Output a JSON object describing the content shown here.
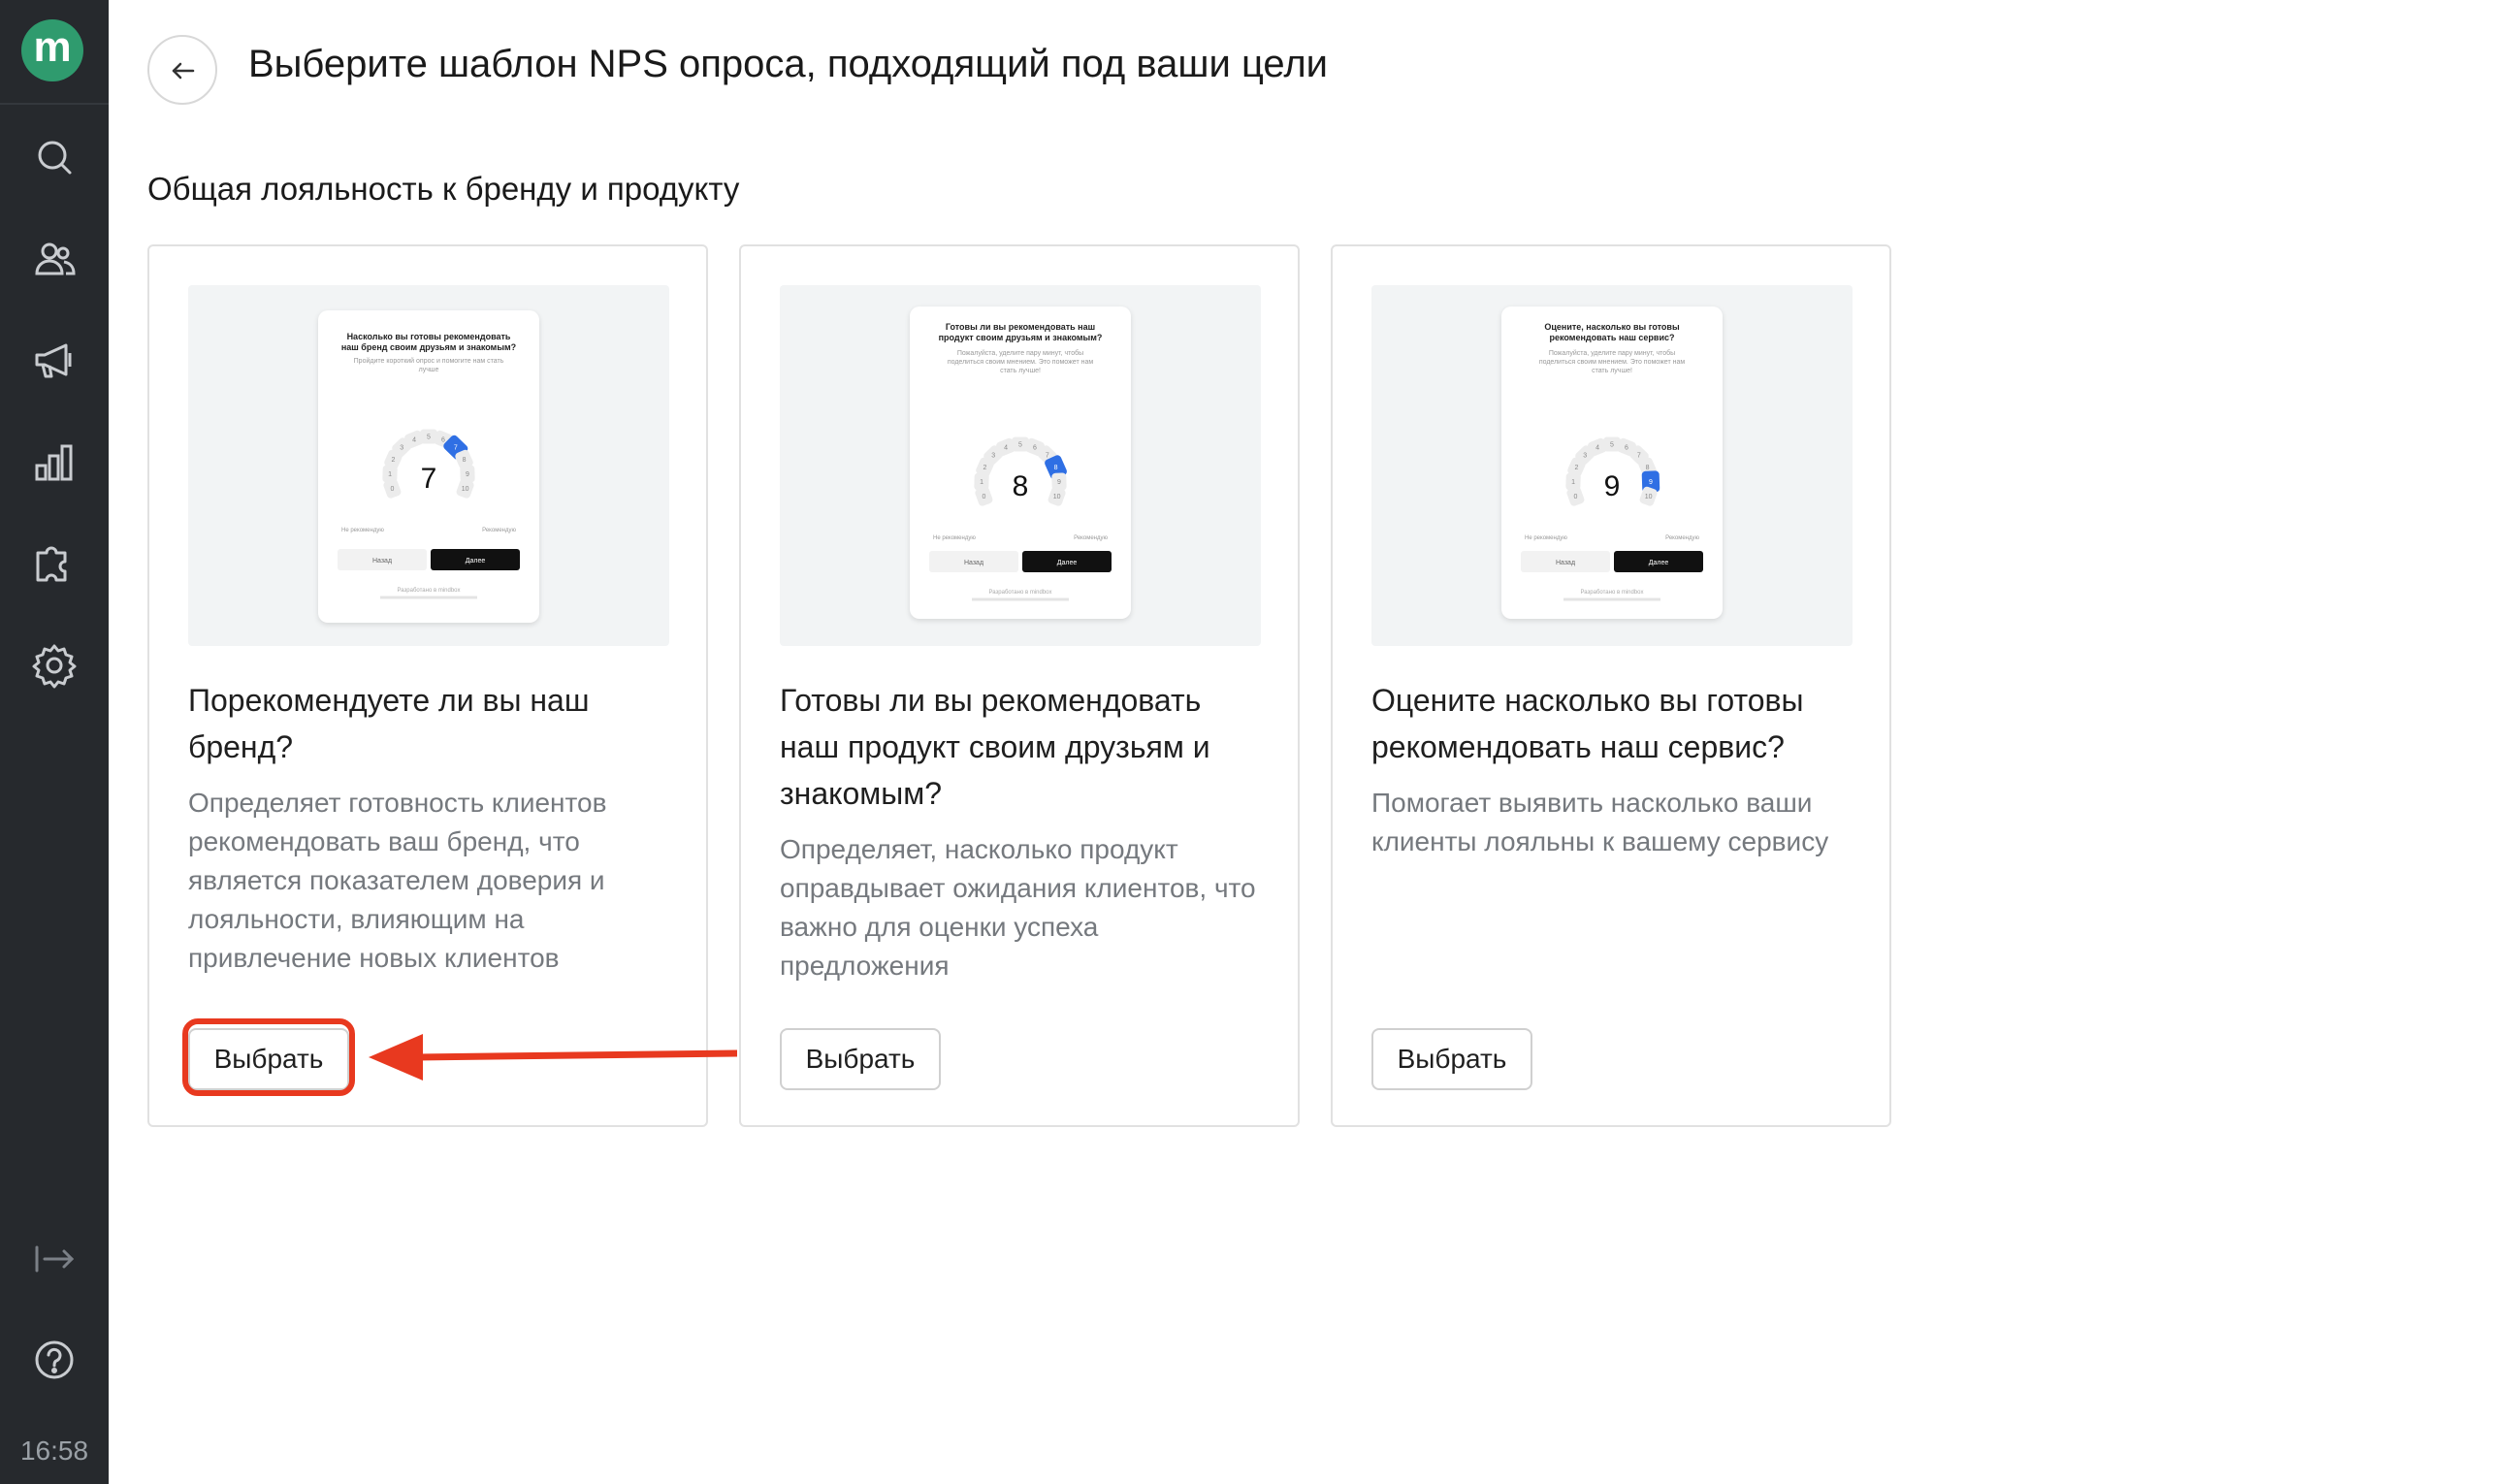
{
  "sidebar": {
    "logo_letter": "m",
    "icons": [
      "search-icon",
      "users-icon",
      "megaphone-icon",
      "chart-icon",
      "puzzle-icon",
      "gear-icon",
      "logout-icon",
      "help-icon"
    ],
    "clock": "16:58"
  },
  "header": {
    "title": "Выберите шаблон NPS опроса, подходящий под ваши цели"
  },
  "section": {
    "title": "Общая лояльность к бренду и продукту"
  },
  "cards": [
    {
      "title": "Порекомендуете ли вы наш бренд?",
      "description": "Определяет готовность клиентов рекомендовать ваш бренд, что является показателем доверия и лояльности, влияющим на привлечение новых клиентов",
      "button": "Выбрать",
      "preview": {
        "question": "Насколько вы готовы рекомендовать наш бренд своим друзьям и знакомым?",
        "hint": "Пройдите короткий опрос и помогите нам стать лучше",
        "score": "7",
        "low_label": "Не рекомендую",
        "high_label": "Рекомендую",
        "back": "Назад",
        "next": "Далее",
        "footer": "Разработано в mindbox"
      }
    },
    {
      "title": "Готовы ли вы рекомендовать наш продукт своим друзьям и знакомым?",
      "description": "Определяет, насколько продукт оправдывает ожидания клиентов, что важно для оценки успеха предложения",
      "button": "Выбрать",
      "preview": {
        "question": "Готовы ли вы рекомендовать наш продукт своим друзьям и знакомым?",
        "hint": "Пожалуйста, уделите пару минут, чтобы поделиться своим мнением. Это поможет нам стать лучше!",
        "score": "8",
        "low_label": "Не рекомендую",
        "high_label": "Рекомендую",
        "back": "Назад",
        "next": "Далее",
        "footer": "Разработано в mindbox"
      }
    },
    {
      "title": "Оцените насколько вы готовы рекомендовать наш сервис?",
      "description": "Помогает выявить насколько ваши клиенты лояльны к вашему сервису",
      "button": "Выбрать",
      "preview": {
        "question": "Оцените, насколько вы готовы рекомендовать наш сервис?",
        "hint": "Пожалуйста, уделите пару минут, чтобы поделиться своим мнением. Это поможет нам стать лучше!",
        "score": "9",
        "low_label": "Не рекомендую",
        "high_label": "Рекомендую",
        "back": "Назад",
        "next": "Далее",
        "footer": "Разработано в mindbox"
      }
    }
  ],
  "colors": {
    "sidebar": "#26292d",
    "logo": "#2f9b6e",
    "accent_blue": "#2f6fe4",
    "highlight_red": "#e8391f"
  }
}
